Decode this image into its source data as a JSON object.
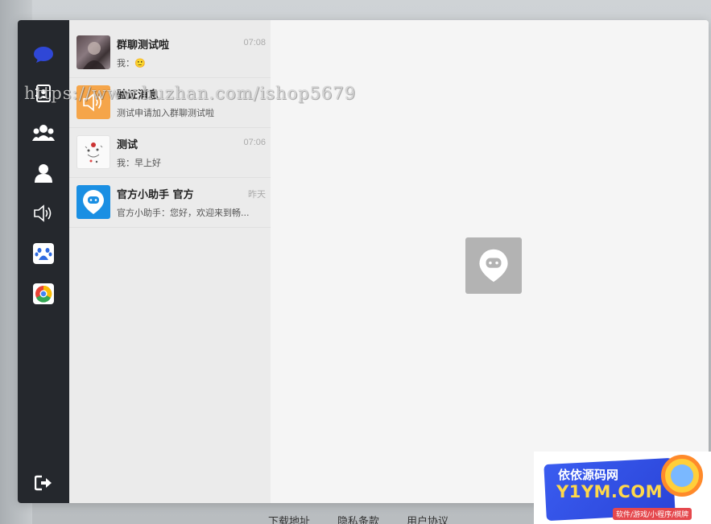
{
  "watermark": "https://www.huzhan.com/ishop5679",
  "sidebar": {
    "items": [
      {
        "icon": "chat-bubble-icon",
        "color": "#2f47d6"
      },
      {
        "icon": "contacts-book-icon"
      },
      {
        "icon": "group-icon"
      },
      {
        "icon": "user-icon"
      },
      {
        "icon": "speaker-icon"
      },
      {
        "icon": "baidu-paw-icon"
      },
      {
        "icon": "browser-icon"
      }
    ],
    "logout_icon": "logout-icon"
  },
  "conversations": [
    {
      "name": "群聊测试啦",
      "time": "07:08",
      "preview": "我：🙂",
      "avatar": "photo-avatar"
    },
    {
      "name": "验证消息",
      "time": "",
      "preview": "测试申请加入群聊测试啦",
      "avatar": "speaker-avatar",
      "avatar_color": "#f5a54a"
    },
    {
      "name": "测试",
      "time": "07:06",
      "preview": "我：早上好",
      "avatar": "sketch-avatar"
    },
    {
      "name": "官方小助手 官方",
      "time": "昨天",
      "preview": "官方小助手：您好，欢迎来到畅...",
      "avatar": "assistant-avatar",
      "avatar_color": "#1a8fe3"
    }
  ],
  "footer": {
    "download": "下载地址",
    "privacy": "隐私条款",
    "agreement": "用户协议"
  },
  "badge": {
    "title": "依依源码网",
    "domain": "Y1YM.COM",
    "tagline": "软件/游戏/小程序/棋牌"
  }
}
